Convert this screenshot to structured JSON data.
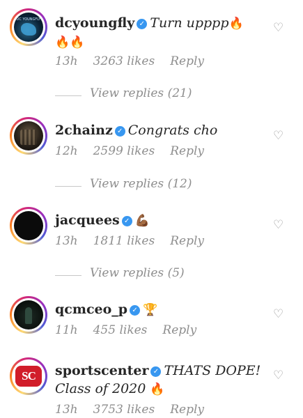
{
  "comments": [
    {
      "username": "dcyoungfly",
      "text": "Turn upppp",
      "emoji_inline": "🔥",
      "emoji_line2": "🔥🔥",
      "time": "13h",
      "likes": "3263 likes",
      "reply": "Reply",
      "view_replies": "View replies (21)",
      "avatar_text": "DC YOUNGFLY"
    },
    {
      "username": "2chainz",
      "text": "Congrats cho",
      "time": "12h",
      "likes": "2599 likes",
      "reply": "Reply",
      "view_replies": "View replies (12)"
    },
    {
      "username": "jacquees",
      "emoji_inline": "💪🏾",
      "time": "13h",
      "likes": "1811 likes",
      "reply": "Reply",
      "view_replies": "View replies (5)"
    },
    {
      "username": "qcmceo_p",
      "emoji_inline": "🏆",
      "time": "11h",
      "likes": "455 likes",
      "reply": "Reply"
    },
    {
      "username": "sportscenter",
      "text": "THATS DOPE!",
      "text_line2": "Class of 2020",
      "emoji_line2": "🔥",
      "time": "13h",
      "likes": "3753 likes",
      "reply": "Reply",
      "avatar_text": "SC"
    }
  ],
  "icons": {
    "verified": "✓",
    "heart": "♡"
  },
  "colors": {
    "verified_blue": "#3897f0",
    "meta_gray": "#8e8e8e",
    "sportscenter_red": "#d11d2a"
  }
}
